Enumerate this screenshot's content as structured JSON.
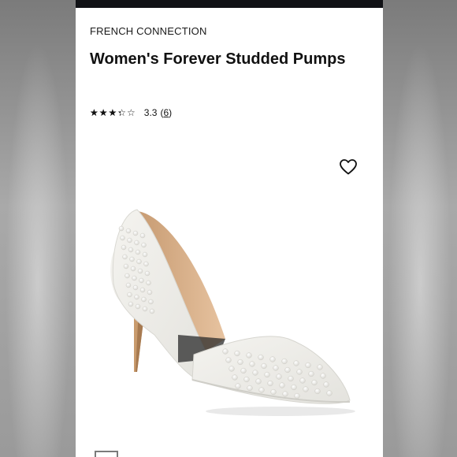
{
  "product": {
    "brand": "FRENCH CONNECTION",
    "title": "Women's Forever Studded Pumps",
    "rating": {
      "score": "3.3",
      "count": "6",
      "stars_value": 3.3,
      "stars_max": 5
    }
  },
  "colors": {
    "top_bar": "#111216",
    "shoe": "#f1f0ec",
    "lining": "#d9b08c",
    "heel": "#c99b6d"
  },
  "icons": {
    "favorite": "heart-outline-icon",
    "stars": "star-rating-icon"
  }
}
